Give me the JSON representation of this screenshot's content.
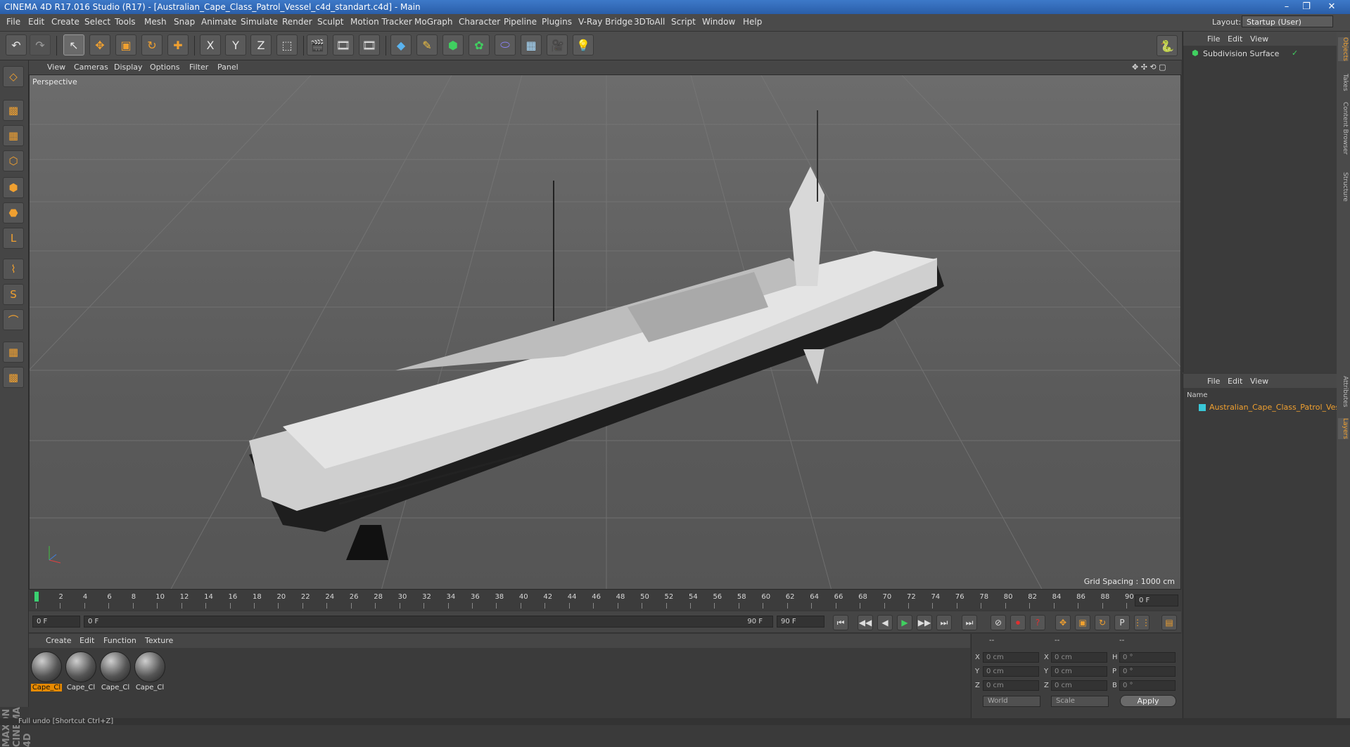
{
  "title": "CINEMA 4D R17.016 Studio (R17) - [Australian_Cape_Class_Patrol_Vessel_c4d_standart.c4d] - Main",
  "window_controls": [
    "–",
    "❐",
    "✕"
  ],
  "menubar": [
    "File",
    "Edit",
    "Create",
    "Select",
    "Tools",
    "Mesh",
    "Snap",
    "Animate",
    "Simulate",
    "Render",
    "Sculpt",
    "Motion Tracker",
    "MoGraph",
    "Character",
    "Pipeline",
    "Plugins",
    "V-Ray Bridge",
    "3DToAll",
    "Script",
    "Window",
    "Help"
  ],
  "layout": {
    "label": "Layout:",
    "value": "Startup (User)"
  },
  "toolbar": {
    "undo": "↶",
    "redo": "↷",
    "tools": [
      "↖",
      "✥",
      "▣",
      "↻",
      "✚",
      "X",
      "Y",
      "Z",
      "⬚",
      "🎬",
      "🎞",
      "🎞",
      "◆",
      "✎",
      "⬢",
      "✿",
      "⬭",
      "▦",
      "🎥",
      "💡"
    ]
  },
  "python_icon": "🐍",
  "lefttools": [
    "◇",
    "▩",
    "▦",
    "⬡",
    "⬢",
    "⬣",
    "L",
    "⌇",
    "S",
    "⌒",
    "▦",
    "▩"
  ],
  "viewport": {
    "menu": [
      "View",
      "Cameras",
      "Display",
      "Options",
      "Filter",
      "Panel"
    ],
    "label": "Perspective",
    "grid_spacing": "Grid Spacing : 1000 cm",
    "nav_icons": "✥ ✣ ⟲ ▢"
  },
  "timeline": {
    "ticks": [
      "0",
      "2",
      "4",
      "6",
      "8",
      "10",
      "12",
      "14",
      "16",
      "18",
      "20",
      "22",
      "24",
      "26",
      "28",
      "30",
      "32",
      "34",
      "36",
      "38",
      "40",
      "42",
      "44",
      "46",
      "48",
      "50",
      "52",
      "54",
      "56",
      "58",
      "60",
      "62",
      "64",
      "66",
      "68",
      "70",
      "72",
      "74",
      "76",
      "78",
      "80",
      "82",
      "84",
      "86",
      "88",
      "90"
    ],
    "current_frame": "0 F"
  },
  "transport": {
    "start": "0 F",
    "range_start": "0 F",
    "range_end": "90 F",
    "end": "90 F",
    "buttons": [
      "⏮",
      "◀◀",
      "◀",
      "▶",
      "▶▶",
      "⏭",
      "⏭"
    ],
    "rec_buttons": [
      "⊘",
      "⏺",
      "?",
      "✥",
      "▣",
      "↻",
      "P",
      "⋮⋮",
      "▤"
    ]
  },
  "materials": {
    "menu": [
      "Create",
      "Edit",
      "Function",
      "Texture"
    ],
    "items": [
      "Cape_Cl",
      "Cape_Cl",
      "Cape_Cl",
      "Cape_Cl"
    ]
  },
  "coords": {
    "header": [
      "--",
      "--",
      "--"
    ],
    "rows": [
      {
        "a": "X",
        "av": "0 cm",
        "b": "X",
        "bv": "0 cm",
        "c": "H",
        "cv": "0 °"
      },
      {
        "a": "Y",
        "av": "0 cm",
        "b": "Y",
        "bv": "0 cm",
        "c": "P",
        "cv": "0 °"
      },
      {
        "a": "Z",
        "av": "0 cm",
        "b": "Z",
        "bv": "0 cm",
        "c": "B",
        "cv": "0 °"
      }
    ],
    "dd1": "World",
    "dd2": "Scale",
    "apply": "Apply"
  },
  "objects": {
    "menu": [
      "File",
      "Edit",
      "View"
    ],
    "item": "Subdivision Surface"
  },
  "layers": {
    "menu": [
      "File",
      "Edit",
      "View"
    ],
    "col": "Name",
    "item": "Australian_Cape_Class_Patrol_Ves"
  },
  "sidetabs": [
    "Objects",
    "Takes",
    "Content Browser",
    "Structure",
    "Attributes",
    "Layers"
  ],
  "status": "Full undo [Shortcut Ctrl+Z]",
  "brand": "MAXON CINEMA 4D",
  "colors": {
    "accent": "#e88a00",
    "layer_swatch": "#39c8d8"
  }
}
